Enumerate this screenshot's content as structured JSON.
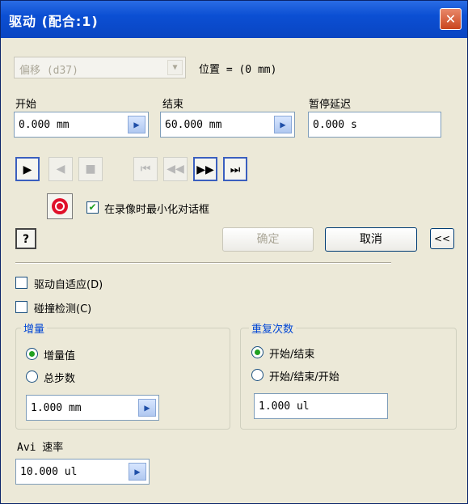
{
  "window": {
    "title": "驱动 (配合:1)",
    "close_glyph": "✕"
  },
  "offset": {
    "combo_value": "偏移 (d37)",
    "position_text": "位置 = (0 mm)"
  },
  "start": {
    "label": "开始",
    "value": "0.000 mm"
  },
  "end": {
    "label": "结束",
    "value": "60.000 mm"
  },
  "pause": {
    "label": "暂停延迟",
    "value": "0.000 s"
  },
  "record": {
    "minimize_label": "在录像时最小化对话框",
    "minimize_checked": true
  },
  "buttons": {
    "ok": "确定",
    "cancel": "取消",
    "collapse": "<<"
  },
  "options": {
    "adaptive": "驱动自适应(D)",
    "collision": "碰撞检测(C)"
  },
  "increment": {
    "title": "增量",
    "option1": "增量值",
    "option2": "总步数",
    "value": "1.000 mm",
    "selected": "增量值"
  },
  "repeat": {
    "title": "重复次数",
    "option1": "开始/结束",
    "option2": "开始/结束/开始",
    "value": "1.000 ul",
    "selected": "开始/结束"
  },
  "avi": {
    "label": "Avi 速率",
    "value": "10.000 ul"
  },
  "icons": [
    "play-forward-icon",
    "play-reverse-icon",
    "stop-icon",
    "rewind-to-start-icon",
    "step-reverse-icon",
    "step-forward-icon",
    "forward-to-end-icon",
    "record-icon",
    "help-icon",
    "spin-arrow-icon",
    "close-icon"
  ],
  "colors": {
    "title_bar": "#0b4fd3",
    "dialog_bg": "#ece9d8",
    "group_title": "#0046d5",
    "check": "#21a121",
    "record": "#e0102a"
  }
}
